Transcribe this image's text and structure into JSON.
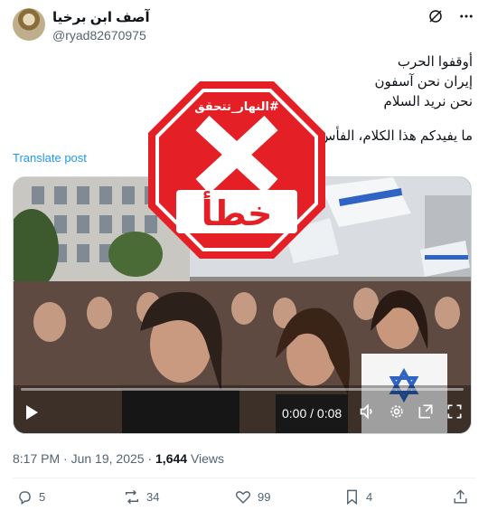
{
  "header": {
    "display_name": "آصف ابن برخيا",
    "handle": "@ryad82670975",
    "icons": [
      "grok-icon",
      "more-icon"
    ]
  },
  "post": {
    "lines": [
      "أوقفوا الحرب",
      "إيران نحن آسفون",
      "نحن نريد السلام"
    ],
    "last_line": "ما يفيدكم هذا الكلام، الفأس وقعت في الراس عليكم"
  },
  "translate_label": "Translate post",
  "stamp": {
    "hashtag": "#النهار_تتحقق",
    "verdict": "خطأ",
    "color": "#e51f26"
  },
  "video": {
    "time": "0:00 / 0:08",
    "progress": 0,
    "controls": [
      "play-icon",
      "volume-icon",
      "settings-icon",
      "pip-icon",
      "fullscreen-icon"
    ]
  },
  "meta": {
    "time": "8:17 PM",
    "separator": " · ",
    "date": "Jun 19, 2025",
    "views_count": "1,644",
    "views_label": " Views"
  },
  "actions": {
    "replies": "5",
    "reposts": "34",
    "likes": "99",
    "bookmarks": "4"
  }
}
